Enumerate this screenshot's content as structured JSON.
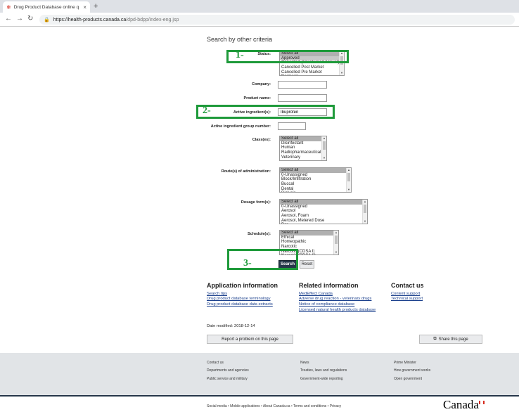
{
  "browser": {
    "tab_title": "Drug Product Database online q",
    "tab_close": "×",
    "new_tab": "+",
    "url_domain": "https://health-products.canada.ca",
    "url_path": "/dpd-bdpp/index-eng.jsp"
  },
  "page": {
    "heading": "Search by other criteria",
    "status": {
      "label": "Status:",
      "options": [
        "Select all",
        "Approved",
        "Cancelled (Unreturned Annual)",
        "Cancelled Post Market",
        "Cancelled Pre Market",
        "Dormant"
      ]
    },
    "company": {
      "label": "Company:",
      "value": ""
    },
    "product_name": {
      "label": "Product name:",
      "value": ""
    },
    "active_ingredient": {
      "label": "Active ingredient(s):",
      "value": "Ibuprofen"
    },
    "ingredient_group": {
      "label": "Active ingredient group number:",
      "value": ""
    },
    "classes": {
      "label": "Class(es):",
      "options": [
        "Select all",
        "Disinfectant",
        "Human",
        "Radiopharmaceutical",
        "Veterinary"
      ]
    },
    "routes": {
      "label": "Route(s) of administration:",
      "options": [
        "Select all",
        "0-Unassigned",
        "Block/Infiltration",
        "Buccal",
        "Dental",
        "Dialysis"
      ]
    },
    "dosage_forms": {
      "label": "Dosage form(s):",
      "options": [
        "Select all",
        "0-Unassigned",
        "Aerosol",
        "Aerosol, Foam",
        "Aerosol, Metered Dose",
        "Bar"
      ]
    },
    "schedules": {
      "label": "Schedule(s):",
      "options": [
        "Select all",
        "Ethical",
        "Homeopathic",
        "Narcotic",
        "Narcotic (CDSA I)",
        "Narcotic (CDSA II)"
      ]
    },
    "search_label": "Search",
    "reset_label": "Reset",
    "annotations": [
      "1-",
      "2-",
      "3-"
    ],
    "annotation_color": "#1e9a3a"
  },
  "info": {
    "app_heading": "Application information",
    "app_links": [
      "Search tips",
      "Drug product database terminology",
      "Drug product database data extracts"
    ],
    "related_heading": "Related information",
    "related_links": [
      "MedEffect Canada",
      "Adverse drug reaction - veterinary drugs",
      "Notice of compliance database",
      "Licensed natural health products database"
    ],
    "contact_heading": "Contact us",
    "contact_links": [
      "Content support",
      "Technical support"
    ]
  },
  "date_modified": "Date modified:  2018-12-14",
  "report_label": "Report a problem on this page",
  "share_label": "Share this page",
  "footer": {
    "col1": [
      "Contact us",
      "Departments and agencies",
      "Public service and military"
    ],
    "col2": [
      "News",
      "Treaties, laws and regulations",
      "Government-wide reporting"
    ],
    "col3": [
      "Prime Minister",
      "How government works",
      "Open government"
    ],
    "bottom": "Social media  •  Mobile applications  •  About Canada.ca  •  Terms and conditions  •  Privacy",
    "wordmark": "Canada"
  }
}
